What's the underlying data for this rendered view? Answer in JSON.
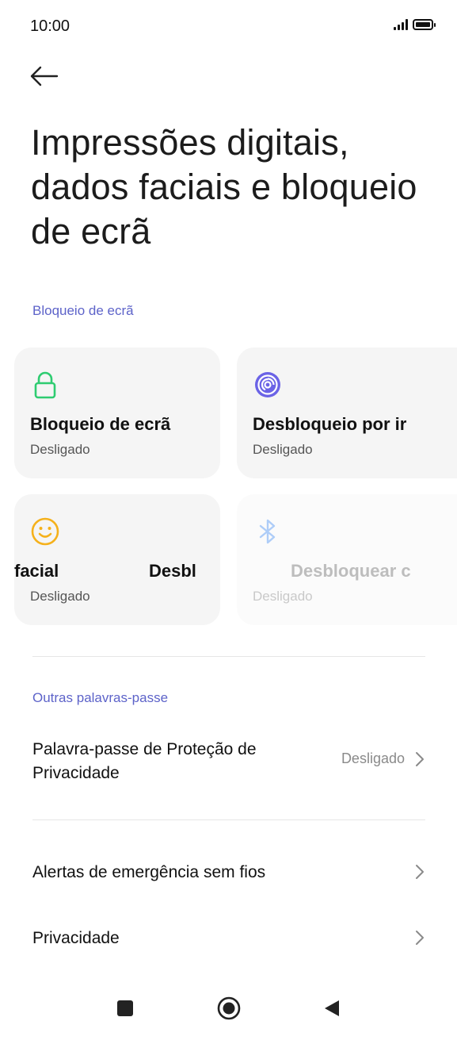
{
  "status_bar": {
    "time": "10:00",
    "signal_icon": "signal-bars-icon",
    "battery_icon": "battery-icon"
  },
  "header": {
    "back_icon": "arrow-left-icon",
    "title": "Impressões digitais, dados faciais e bloqueio de ecrã"
  },
  "lock_section": {
    "label": "Bloqueio de ecrã",
    "cards": [
      {
        "title": "Bloqueio de ecrã",
        "status": "Desligado",
        "icon": "lock-icon",
        "icon_color": "#2ecc71"
      },
      {
        "title": "Desbloqueio por ir",
        "status": "Desligado",
        "icon": "fingerprint-icon",
        "icon_color": "#6b63e6"
      },
      {
        "title_left": "facial",
        "title_right": "Desbl",
        "status": "Desligado",
        "icon": "smiley-face-icon",
        "icon_color": "#f5b11b"
      },
      {
        "title": "Desbloquear c",
        "status": "Desligado",
        "icon": "bluetooth-icon",
        "icon_color": "#aecdf8",
        "disabled": true
      }
    ]
  },
  "other_section": {
    "label": "Outras palavras-passe",
    "privacy_password": {
      "title_line1": "Palavra-passe de Proteção de",
      "title_line2": "Privacidade",
      "value": "Desligado"
    }
  },
  "list": {
    "emergency_alerts": "Alertas de emergência sem fios",
    "privacy": "Privacidade"
  },
  "nav_bar": {
    "recents_icon": "square-icon",
    "home_icon": "circle-home-icon",
    "back_icon": "triangle-back-icon"
  },
  "colors": {
    "accent": "#5d63c9",
    "card_bg": "#f5f5f5"
  }
}
